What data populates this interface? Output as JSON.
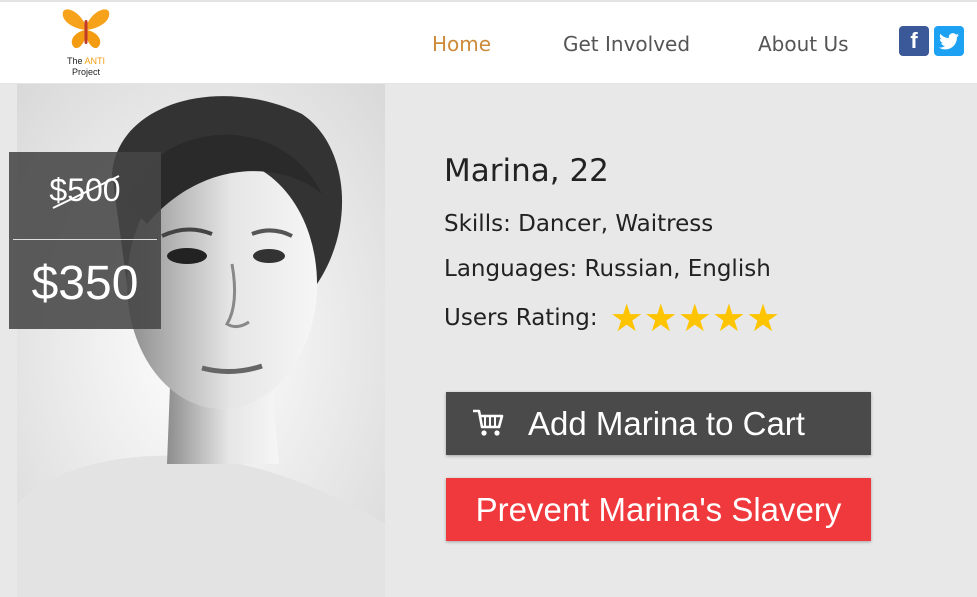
{
  "header": {
    "logo": {
      "line1_prefix": "The ",
      "line1_accent": "ANTI",
      "line2": "Project"
    },
    "nav": [
      {
        "label": "Home",
        "active": true
      },
      {
        "label": "Get Involved",
        "active": false
      },
      {
        "label": "About Us",
        "active": false
      }
    ],
    "social": {
      "facebook_glyph": "f",
      "facebook_color": "#3b5998",
      "twitter_color": "#1da1f2"
    }
  },
  "listing": {
    "old_price": "$500",
    "new_price": "$350",
    "name_age": "Marina, 22",
    "skills": "Skills: Dancer, Waitress",
    "languages": "Languages: Russian, English",
    "rating_label": "Users Rating:",
    "rating_stars": 5,
    "rating_max": 5
  },
  "buttons": {
    "add_to_cart": "Add Marina to Cart",
    "prevent": "Prevent Marina's Slavery"
  },
  "colors": {
    "accent_nav": "#cc8a3a",
    "star": "#ffc400",
    "cart_button": "#4a4a4a",
    "prevent_button": "#f0393d"
  }
}
